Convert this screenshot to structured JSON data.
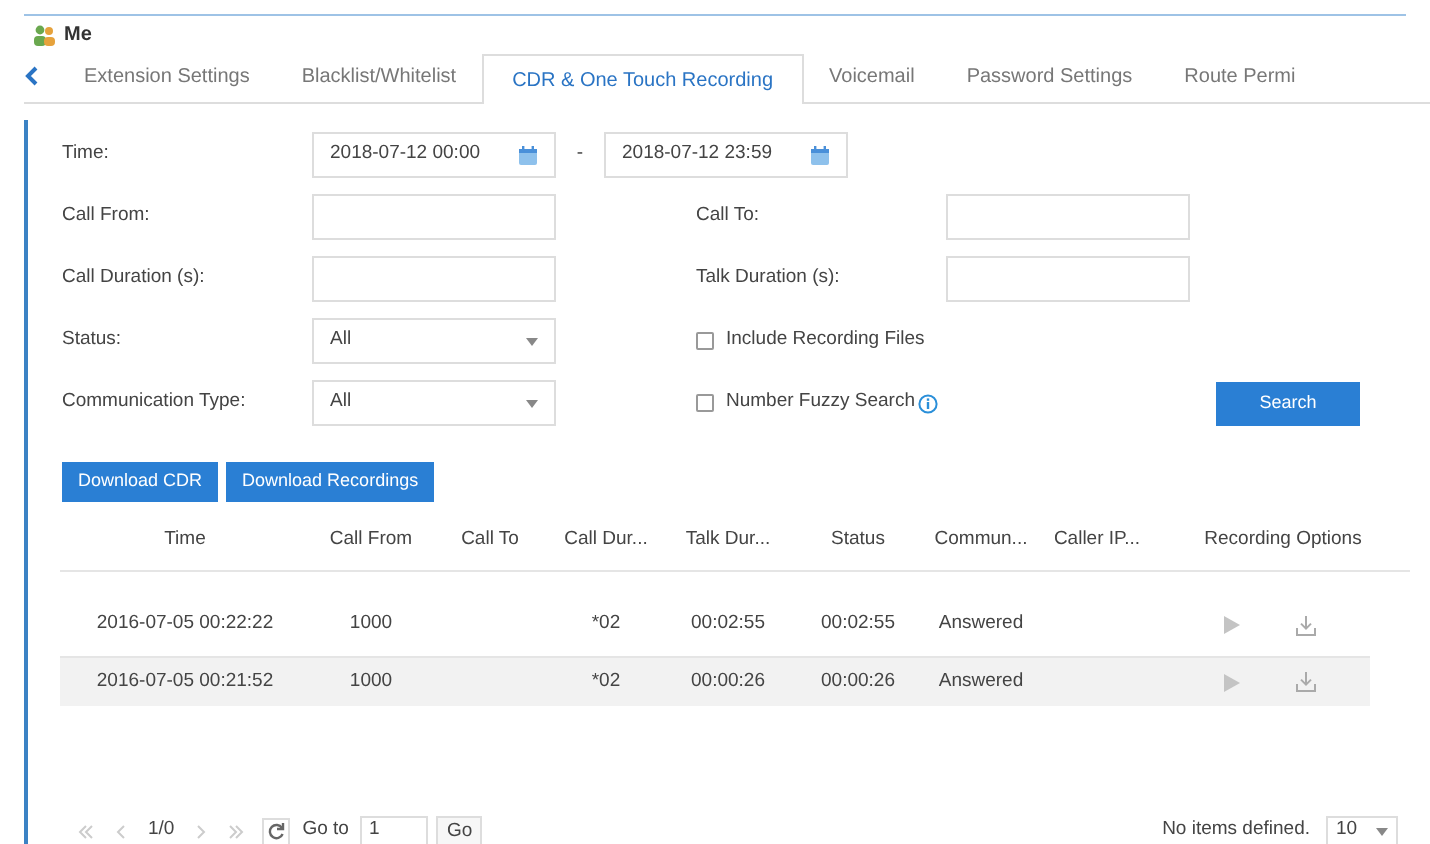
{
  "window": {
    "title": "Me"
  },
  "tabs": [
    {
      "label": "Extension Settings",
      "selected": false
    },
    {
      "label": "Blacklist/Whitelist",
      "selected": false
    },
    {
      "label": "CDR & One Touch Recording",
      "selected": true
    },
    {
      "label": "Voicemail",
      "selected": false
    },
    {
      "label": "Password Settings",
      "selected": false
    },
    {
      "label": "Route Permi",
      "selected": false
    }
  ],
  "filters": {
    "time_label": "Time:",
    "time_from": "2018-07-12 00:00",
    "time_sep": "-",
    "time_to": "2018-07-12 23:59",
    "call_from_label": "Call From:",
    "call_to_label": "Call To:",
    "call_duration_label": "Call Duration (s):",
    "talk_duration_label": "Talk Duration (s):",
    "status_label": "Status:",
    "status_value": "All",
    "comm_type_label": "Communication Type:",
    "comm_type_value": "All",
    "include_recording": {
      "label": "Include Recording Files",
      "checked": false
    },
    "fuzzy_search": {
      "label": "Number Fuzzy Search",
      "checked": false
    },
    "search_button": "Search"
  },
  "actions": [
    "Download CDR",
    "Download Recordings"
  ],
  "table": {
    "columns": [
      "Time",
      "Call From",
      "Call To",
      "Call Dur...",
      "Talk Dur...",
      "Status",
      "Commun...",
      "Caller IP...",
      "Recording Options"
    ],
    "rows": [
      {
        "cells": [
          "2016-07-05 00:22:22",
          "1000",
          "",
          "*02",
          "00:02:55",
          "00:02:55",
          "Answered",
          ""
        ],
        "selected": false
      },
      {
        "cells": [
          "2016-07-05 00:21:52",
          "1000",
          "",
          "*02",
          "00:00:26",
          "00:00:26",
          "Answered",
          ""
        ],
        "selected": true
      }
    ]
  },
  "pagination": {
    "page": "1/0",
    "goto_label": "Go to",
    "goto_value": "1",
    "go_button": "Go",
    "summary": "No items defined.",
    "page_size": "10"
  }
}
